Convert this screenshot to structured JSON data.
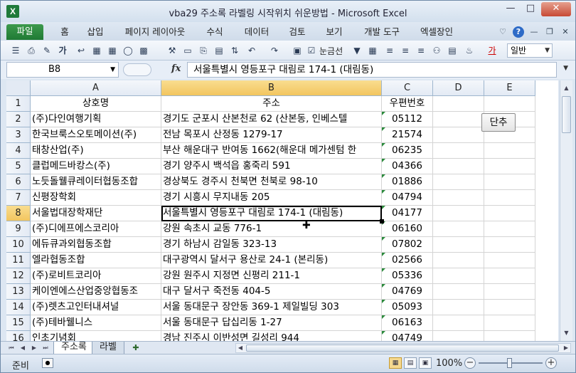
{
  "window": {
    "title": "vba29 주소록 라벨링 시작위치 쉬운방법  -  Microsoft Excel",
    "app_icon": "X"
  },
  "ribbon": {
    "tabs": [
      "파일",
      "홈",
      "삽입",
      "페이지 레이아웃",
      "수식",
      "데이터",
      "검토",
      "보기",
      "개발 도구",
      "엑셀장인"
    ]
  },
  "toolbar": {
    "bold_label": "가",
    "gridlines_label": "눈금선",
    "font_color_label": "가",
    "number_format": "일반"
  },
  "formula_bar": {
    "name_box": "B8",
    "fx": "fx",
    "content": "서울특별시 영등포구 대림로 174-1 (대림동)"
  },
  "grid": {
    "columns": [
      "A",
      "B",
      "C",
      "D",
      "E"
    ],
    "selected_column": "B",
    "selected_row": 8,
    "header_row": [
      "상호명",
      "주소",
      "우편번호",
      "",
      ""
    ],
    "rows": [
      {
        "num": 2,
        "name": "(주)다인여행기획",
        "addr": "경기도 군포시 산본천로 62 (산본동, 인베스텔",
        "zip": "05112"
      },
      {
        "num": 3,
        "name": "한국브룩스오토메이션(주)",
        "addr": "전남 목포시 산정동 1279-17",
        "zip": "21574"
      },
      {
        "num": 4,
        "name": "태창산업(주)",
        "addr": "부산 해운대구 반여동 1662(해운대 메가센텀 한",
        "zip": "06235"
      },
      {
        "num": 5,
        "name": "클럽메드바캉스(주)",
        "addr": "경기 양주시 백석읍 홍죽리 591",
        "zip": "04366"
      },
      {
        "num": 6,
        "name": "노듯돌웰큐레이터협동조합",
        "addr": "경상북도 경주시 천북면 천북로 98-10",
        "zip": "01886"
      },
      {
        "num": 7,
        "name": "신평장학회",
        "addr": "경기 시흥시 무지내동 205",
        "zip": "04794"
      },
      {
        "num": 8,
        "name": "서울법대장학재단",
        "addr": "서울특별시 영등포구 대림로 174-1 (대림동)",
        "zip": "04177"
      },
      {
        "num": 9,
        "name": "(주)디에프에스코리아",
        "addr": "강원 속초시 교동 776-1",
        "zip": "06160"
      },
      {
        "num": 10,
        "name": "에듀큐과외협동조합",
        "addr": "경기 하남시 감일동 323-13",
        "zip": "07802"
      },
      {
        "num": 11,
        "name": "엘라협동조합",
        "addr": "대구광역시 달서구 용산로 24-1 (본리동)",
        "zip": "02566"
      },
      {
        "num": 12,
        "name": "(주)로비트코리아",
        "addr": "강원 원주시 지정면 신평리 211-1",
        "zip": "05336"
      },
      {
        "num": 13,
        "name": "케이엔에스산업중앙협동조",
        "addr": "대구 달서구 죽전동 404-5",
        "zip": "04769"
      },
      {
        "num": 14,
        "name": "(주)렛츠고인터내셔널",
        "addr": "서울 동대문구 장안동 369-1 제일빌딩 303",
        "zip": "05093"
      },
      {
        "num": 15,
        "name": "(주)테바웰니스",
        "addr": "서울 동대문구 답십리동 1-27",
        "zip": "06163"
      },
      {
        "num": 16,
        "name": "인초기념회",
        "addr": "경남 진주시 이반성면 길성리 944",
        "zip": "04749"
      }
    ]
  },
  "button_shortcut": "단추",
  "sheets": {
    "tabs": [
      "주소록",
      "라벨"
    ],
    "active": "주소록"
  },
  "status": {
    "ready": "준비",
    "zoom": "100%"
  },
  "colors": {
    "excel_green": "#1f7a34",
    "selection_header": "#f2c55f",
    "grid_line": "#d4d4d4"
  }
}
